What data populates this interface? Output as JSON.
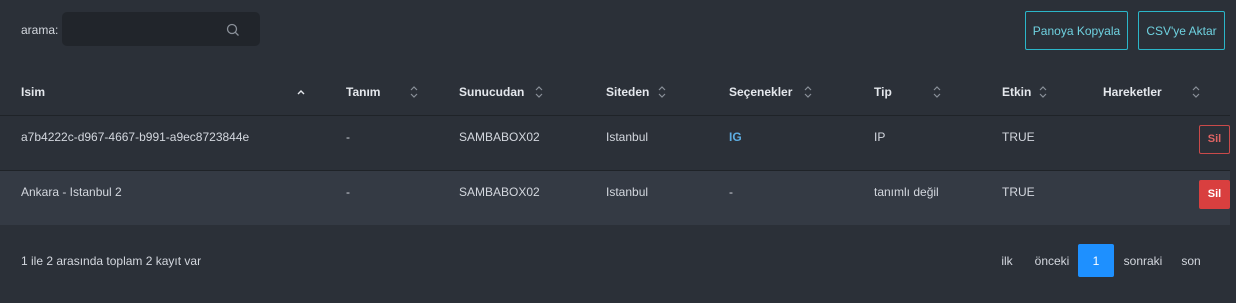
{
  "search": {
    "label": "arama:",
    "value": "",
    "placeholder": ""
  },
  "toolbar": {
    "copy_label": "Panoya Kopyala",
    "csv_label": "CSV'ye Aktar"
  },
  "table": {
    "columns": [
      "Isim",
      "Tanım",
      "Sunucudan",
      "Siteden",
      "Seçenekler",
      "Tip",
      "Etkin",
      "Hareketler"
    ],
    "sorted_column": "Isim",
    "sort_direction": "ascending",
    "rows": [
      {
        "name": "a7b4222c-d967-4667-b991-a9ec8723844e",
        "description": "-",
        "server": "SAMBABOX02",
        "site": "Istanbul",
        "options": "IG",
        "type": "IP",
        "enabled": "TRUE",
        "action": "Sil"
      },
      {
        "name": "Ankara - Istanbul 2",
        "description": "-",
        "server": "SAMBABOX02",
        "site": "Istanbul",
        "options": "-",
        "type": "tanımlı değil",
        "enabled": "TRUE",
        "action": "Sil"
      }
    ]
  },
  "footer": {
    "info": "1 ile 2 arasında toplam 2 kayıt var"
  },
  "pagination": {
    "first": "ilk",
    "previous": "önceki",
    "current": "1",
    "next": "sonraki",
    "last": "son"
  },
  "colors": {
    "background": "#2b3038",
    "accent_teal": "#2bb6c9",
    "danger": "#d93f3f",
    "link": "#5dade2",
    "page_active": "#1e90ff"
  }
}
